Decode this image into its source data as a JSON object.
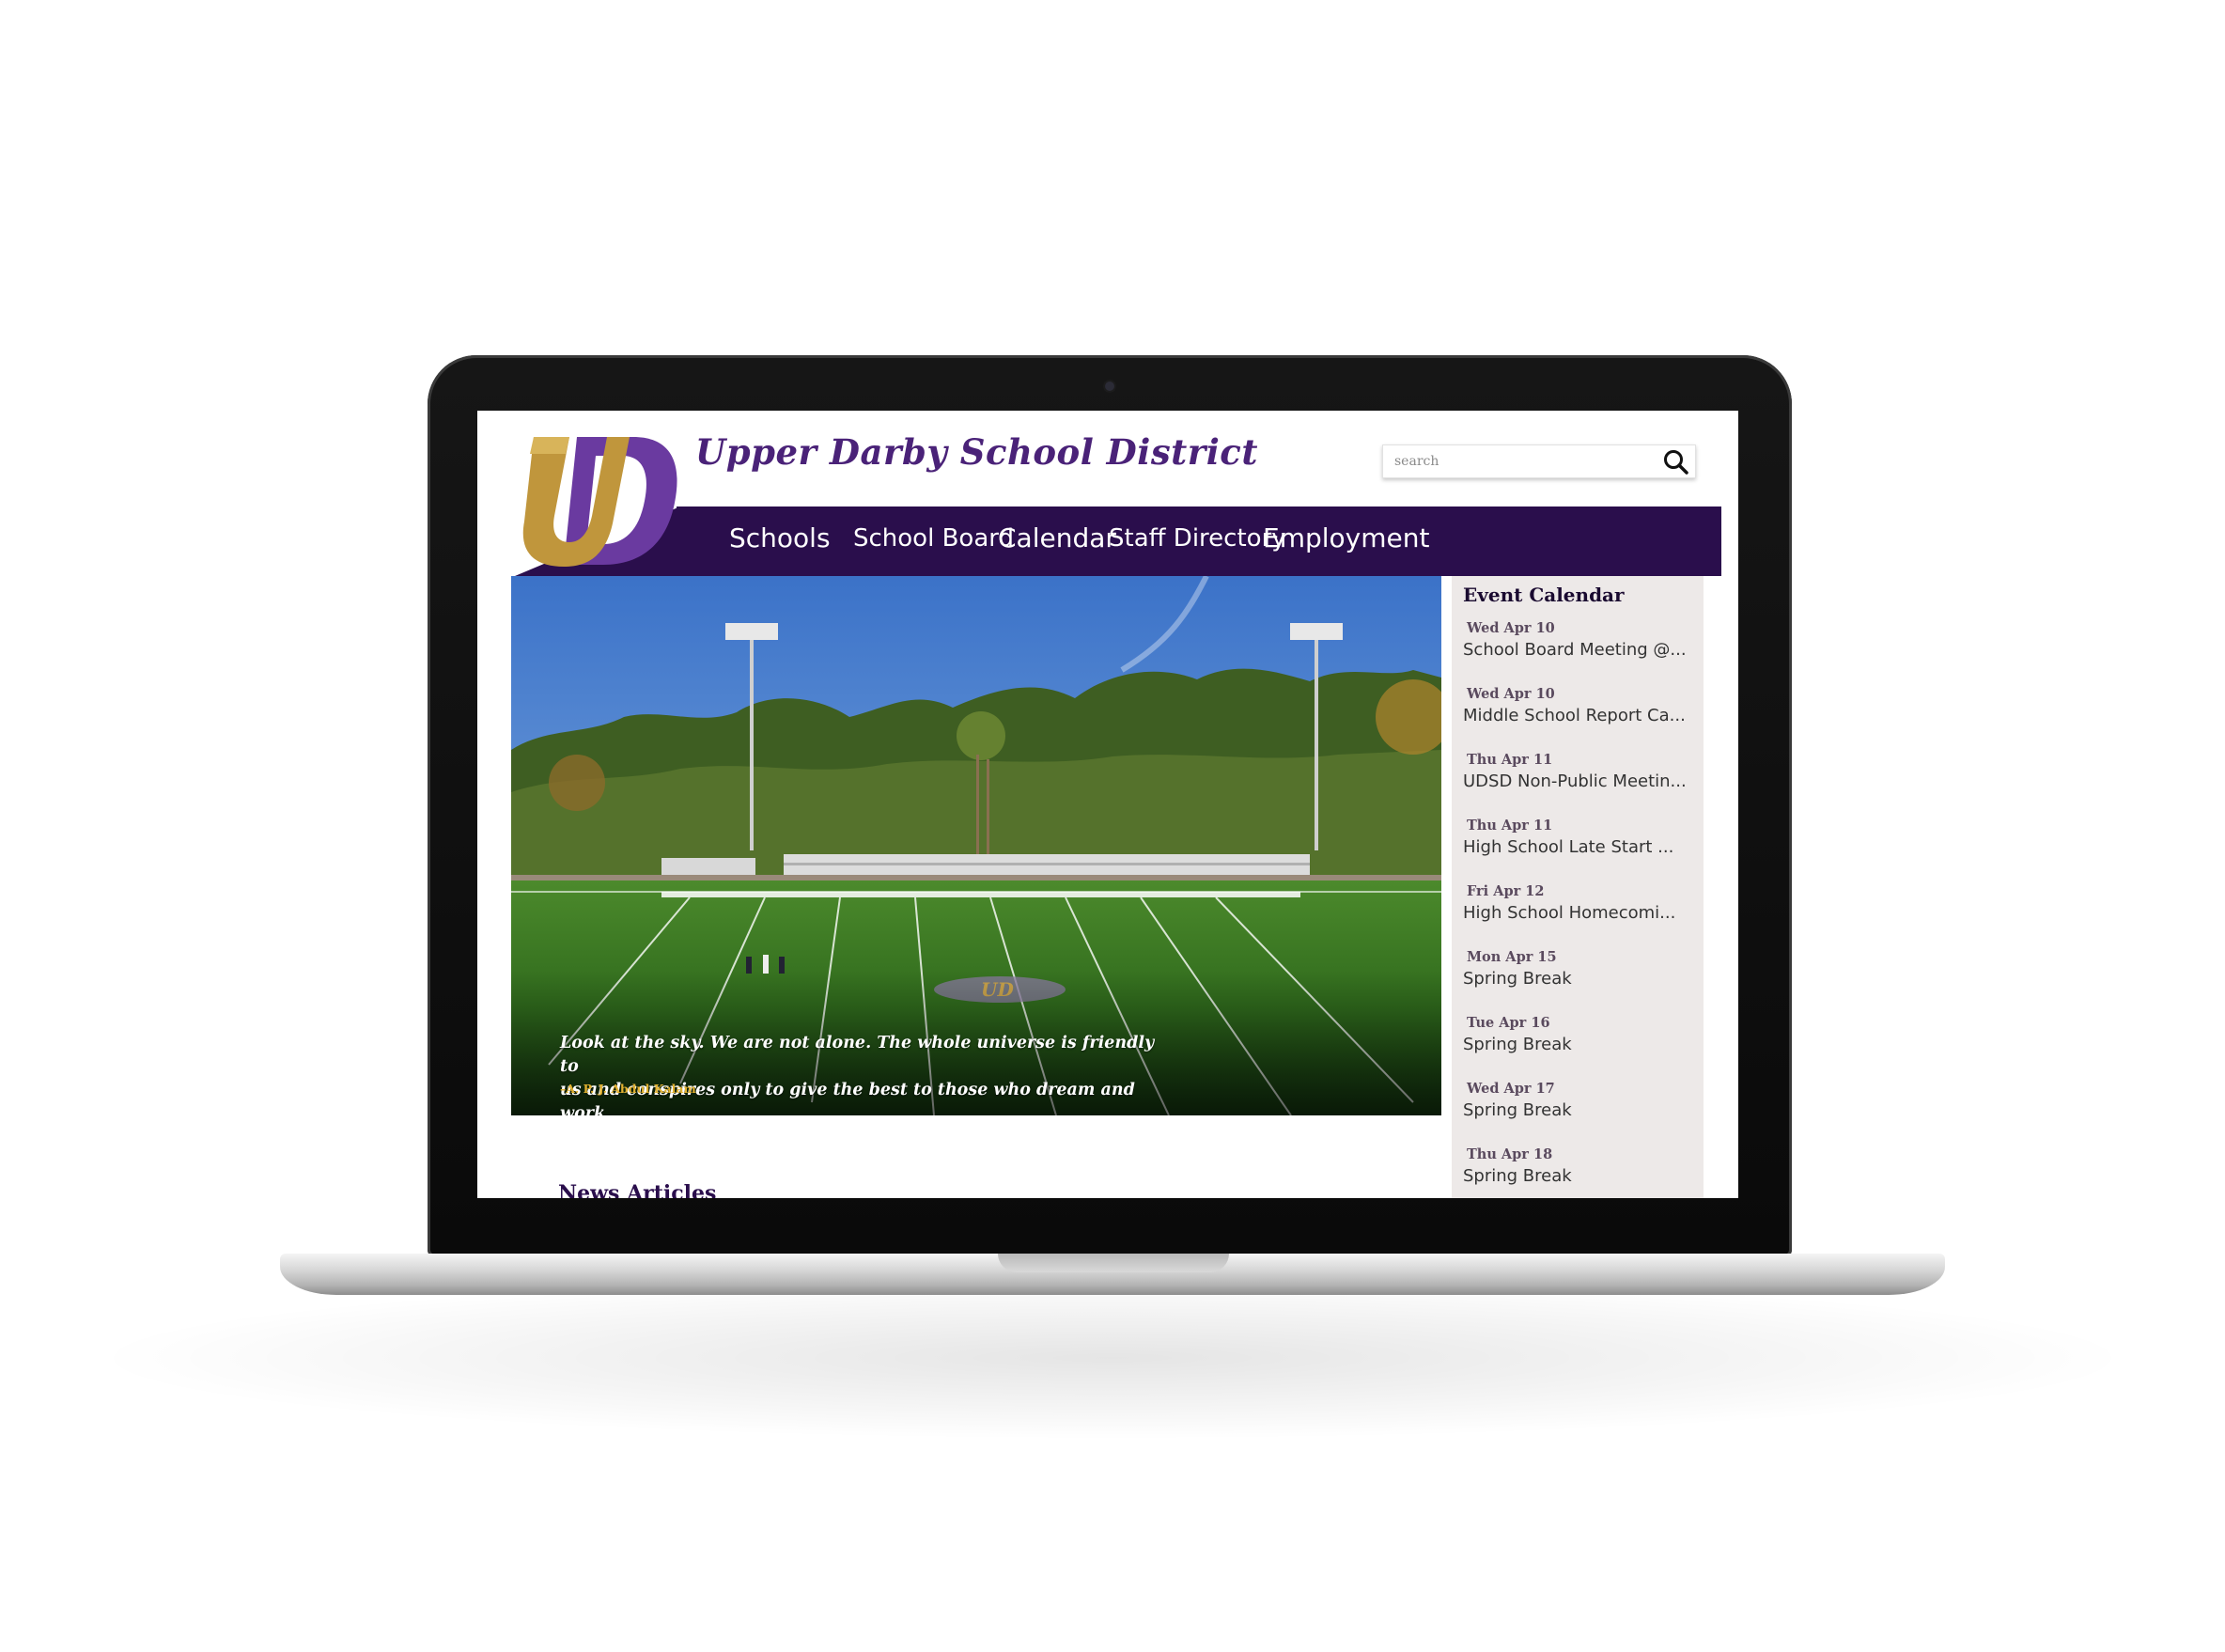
{
  "site": {
    "title": "Upper Darby School District",
    "logo_text": "UD"
  },
  "search": {
    "placeholder": "search",
    "icon": "search-icon"
  },
  "nav": {
    "items": [
      {
        "label": "Schools"
      },
      {
        "label": "School Board"
      },
      {
        "label": "Calendar"
      },
      {
        "label": "Staff Directory"
      },
      {
        "label": "Employment"
      }
    ]
  },
  "hero": {
    "quote_line1": "Look at the sky. We are not alone. The whole universe is friendly to",
    "quote_line2": "us and conspires only to give the best to those who dream and work.",
    "author": "–A. P. J. Abdul Kalam",
    "field_logo_text": "UD"
  },
  "news": {
    "heading": "News Articles"
  },
  "calendar": {
    "title": "Event Calendar",
    "events": [
      {
        "date": "Wed Apr 10",
        "name": "School Board Meeting @..."
      },
      {
        "date": "Wed Apr 10",
        "name": "Middle School Report Ca..."
      },
      {
        "date": "Thu Apr 11",
        "name": "UDSD Non-Public Meetin..."
      },
      {
        "date": "Thu Apr 11",
        "name": "High School Late Start ..."
      },
      {
        "date": "Fri Apr 12",
        "name": "High School Homecomi..."
      },
      {
        "date": "Mon Apr 15",
        "name": "Spring Break"
      },
      {
        "date": "Tue Apr 16",
        "name": "Spring Break"
      },
      {
        "date": "Wed Apr 17",
        "name": "Spring Break"
      },
      {
        "date": "Thu Apr 18",
        "name": "Spring Break"
      }
    ]
  },
  "colors": {
    "brand_purple": "#2a0e4c",
    "logo_gold": "#c0963c",
    "logo_purple": "#6a3aa0",
    "title_purple": "#4a2278",
    "sidebar_bg": "#ede9e8"
  }
}
